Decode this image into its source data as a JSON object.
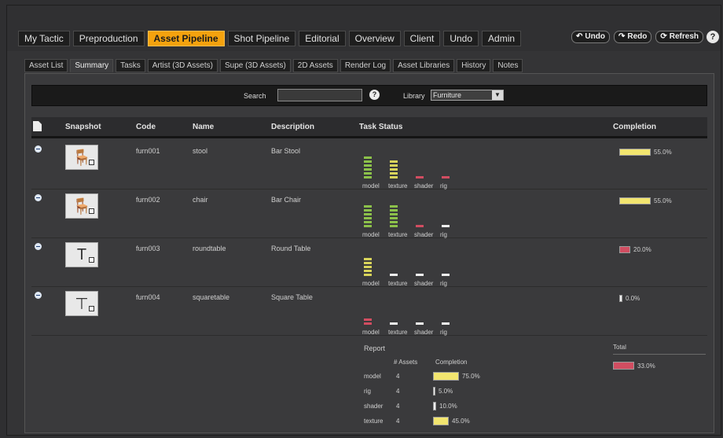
{
  "main_tabs": [
    "My Tactic",
    "Preproduction",
    "Asset Pipeline",
    "Shot Pipeline",
    "Editorial",
    "Overview",
    "Client",
    "Undo",
    "Admin"
  ],
  "main_tabs_active": "Asset Pipeline",
  "actions": {
    "undo": "Undo",
    "redo": "Redo",
    "refresh": "Refresh"
  },
  "sub_tabs": [
    "Asset List",
    "Summary",
    "Tasks",
    "Artist (3D Assets)",
    "Supe (3D Assets)",
    "2D Assets",
    "Render Log",
    "Asset Libraries",
    "History",
    "Notes"
  ],
  "sub_tabs_active": "Summary",
  "search": {
    "label": "Search",
    "value": "",
    "library_label": "Library",
    "library_value": "Furniture"
  },
  "columns": {
    "snapshot": "Snapshot",
    "code": "Code",
    "name": "Name",
    "description": "Description",
    "task_status": "Task Status",
    "completion": "Completion"
  },
  "rows": [
    {
      "code": "furn001",
      "name": "stool",
      "description": "Bar Stool",
      "completion_pct": 55.0,
      "completion_text": "55.0%",
      "bar_color": "#f2e56f",
      "icon": "stool-icon",
      "tasks": [
        {
          "label": "model",
          "color": "#8cc14a",
          "segs": 6
        },
        {
          "label": "texture",
          "color": "#d8d45b",
          "segs": 5
        },
        {
          "label": "shader",
          "color": "#d14d61",
          "segs": 1
        },
        {
          "label": "rig",
          "color": "#d14d61",
          "segs": 1
        }
      ]
    },
    {
      "code": "furn002",
      "name": "chair",
      "description": "Bar Chair",
      "completion_pct": 55.0,
      "completion_text": "55.0%",
      "bar_color": "#f2e56f",
      "icon": "chair-icon",
      "tasks": [
        {
          "label": "model",
          "color": "#8cc14a",
          "segs": 6
        },
        {
          "label": "texture",
          "color": "#8cc14a",
          "segs": 6
        },
        {
          "label": "shader",
          "color": "#d14d61",
          "segs": 1
        },
        {
          "label": "rig",
          "color": "#efefef",
          "segs": 1
        }
      ]
    },
    {
      "code": "furn003",
      "name": "roundtable",
      "description": "Round Table",
      "completion_pct": 20.0,
      "completion_text": "20.0%",
      "bar_color": "#d14d61",
      "icon": "round-table-icon",
      "tasks": [
        {
          "label": "model",
          "color": "#d8d45b",
          "segs": 5
        },
        {
          "label": "texture",
          "color": "#efefef",
          "segs": 1
        },
        {
          "label": "shader",
          "color": "#efefef",
          "segs": 1
        },
        {
          "label": "rig",
          "color": "#efefef",
          "segs": 1
        }
      ]
    },
    {
      "code": "furn004",
      "name": "squaretable",
      "description": "Square Table",
      "completion_pct": 0.0,
      "completion_text": "0.0%",
      "bar_color": "#efefef",
      "icon": "square-table-icon",
      "tasks": [
        {
          "label": "model",
          "color": "#d14d61",
          "segs": 2
        },
        {
          "label": "texture",
          "color": "#efefef",
          "segs": 1
        },
        {
          "label": "shader",
          "color": "#efefef",
          "segs": 1
        },
        {
          "label": "rig",
          "color": "#efefef",
          "segs": 1
        }
      ]
    }
  ],
  "report": {
    "title": "Report",
    "col_assets": "# Assets",
    "col_completion": "Completion",
    "rows": [
      {
        "name": "model",
        "count": "4",
        "pct": 75.0,
        "pct_text": "75.0%",
        "color": "#f2e56f"
      },
      {
        "name": "rig",
        "count": "4",
        "pct": 5.0,
        "pct_text": "5.0%",
        "color": "#efefef"
      },
      {
        "name": "shader",
        "count": "4",
        "pct": 10.0,
        "pct_text": "10.0%",
        "color": "#efefef"
      },
      {
        "name": "texture",
        "count": "4",
        "pct": 45.0,
        "pct_text": "45.0%",
        "color": "#f2e56f"
      }
    ]
  },
  "total": {
    "label": "Total",
    "pct": 33.0,
    "pct_text": "33.0%"
  }
}
